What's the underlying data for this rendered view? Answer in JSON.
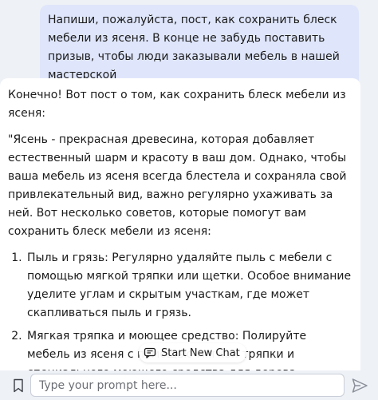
{
  "conversation": {
    "user_message": "Напиши, пожалуйста, пост, как сохранить блеск мебели из ясеня. В конце не забудь поставить призыв,  чтобы люди заказывали мебель в нашей мастерской",
    "assistant": {
      "intro": "Конечно! Вот пост о том, как сохранить блеск мебели из ясеня:",
      "paragraph": "\"Ясень - прекрасная древесина, которая добавляет естественный шарм и красоту в ваш дом. Однако, чтобы ваша мебель из ясеня всегда блестела и сохраняла свой привлекательный вид, важно регулярно ухаживать за ней. Вот несколько советов, которые помогут вам сохранить блеск мебели из ясеня:",
      "tips": [
        "Пыль и грязь: Регулярно удаляйте пыль с мебели с помощью мягкой тряпки или щетки. Особое внимание уделите углам и скрытым участкам, где может скапливаться пыль и грязь.",
        "Мягкая тряпка и моющее средство: Полируйте мебель из ясеня с помощью мягкой тряпки и специального моющего средства для дерева. Помните, что"
      ]
    }
  },
  "start_new_chat": {
    "label": "Start New Chat",
    "icon": "chat-sparkle-icon"
  },
  "composer": {
    "placeholder": "Type your prompt here...",
    "value": "",
    "left_icon": "bookmark-icon",
    "send_icon": "send-icon"
  }
}
